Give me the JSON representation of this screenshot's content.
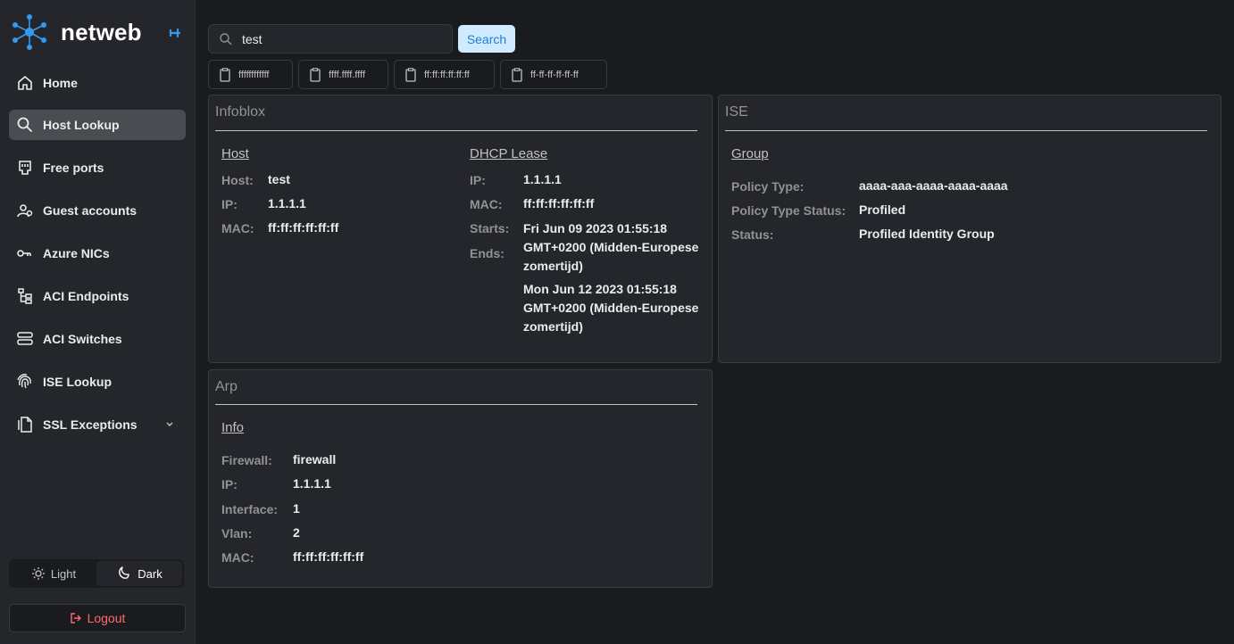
{
  "app": {
    "name": "netweb"
  },
  "nav": [
    {
      "label": "Home",
      "icon": "home-icon"
    },
    {
      "label": "Host Lookup",
      "icon": "search-icon",
      "active": true
    },
    {
      "label": "Free ports",
      "icon": "port-icon"
    },
    {
      "label": "Guest accounts",
      "icon": "users-icon"
    },
    {
      "label": "Azure NICs",
      "icon": "nic-icon"
    },
    {
      "label": "ACI Endpoints",
      "icon": "hierarchy-icon"
    },
    {
      "label": "ACI Switches",
      "icon": "server-icon"
    },
    {
      "label": "ISE Lookup",
      "icon": "fingerprint-icon"
    },
    {
      "label": "SSL Exceptions",
      "icon": "document-icon"
    }
  ],
  "theme": {
    "light": "Light",
    "dark": "Dark",
    "active": "dark"
  },
  "logout": "Logout",
  "search": {
    "value": "test",
    "button": "Search"
  },
  "chips": [
    "ffffffffffff",
    "ffff.ffff.ffff",
    "ff:ff:ff:ff:ff:ff",
    "ff-ff-ff-ff-ff-ff"
  ],
  "infoblox": {
    "title": "Infoblox",
    "host": {
      "title": "Host",
      "host_label": "Host:",
      "host_value": "test",
      "ip_label": "IP:",
      "ip_value": "1.1.1.1",
      "mac_label": "MAC:",
      "mac_value": "ff:ff:ff:ff:ff:ff"
    },
    "dhcp": {
      "title": "DHCP Lease",
      "ip_label": "IP:",
      "ip_value": "1.1.1.1",
      "mac_label": "MAC:",
      "mac_value": "ff:ff:ff:ff:ff:ff",
      "starts_label": "Starts:",
      "starts_value": "Fri Jun 09 2023 01:55:18 GMT+0200 (Midden-Europese zomertijd)",
      "ends_label": "Ends:",
      "ends_value": "Mon Jun 12 2023 01:55:18 GMT+0200 (Midden-Europese zomertijd)"
    }
  },
  "ise": {
    "title": "ISE",
    "group": {
      "title": "Group",
      "policy_type_label": "Policy Type:",
      "policy_type_value": "aaaa-aaa-aaaa-aaaa-aaaa",
      "policy_status_label": "Policy Type Status:",
      "policy_status_value": "Profiled",
      "status_label": "Status:",
      "status_value": "Profiled Identity Group"
    }
  },
  "arp": {
    "title": "Arp",
    "info": {
      "title": "Info",
      "firewall_label": "Firewall:",
      "firewall_value": "firewall",
      "ip_label": "IP:",
      "ip_value": "1.1.1.1",
      "interface_label": "Interface:",
      "interface_value": "1",
      "vlan_label": "Vlan:",
      "vlan_value": "2",
      "mac_label": "MAC:",
      "mac_value": "ff:ff:ff:ff:ff:ff"
    }
  },
  "colors": {
    "accent": "#339af0",
    "danger": "#ff6b6b",
    "button_bg": "#d0ebff",
    "button_text": "#1c7ed6"
  }
}
